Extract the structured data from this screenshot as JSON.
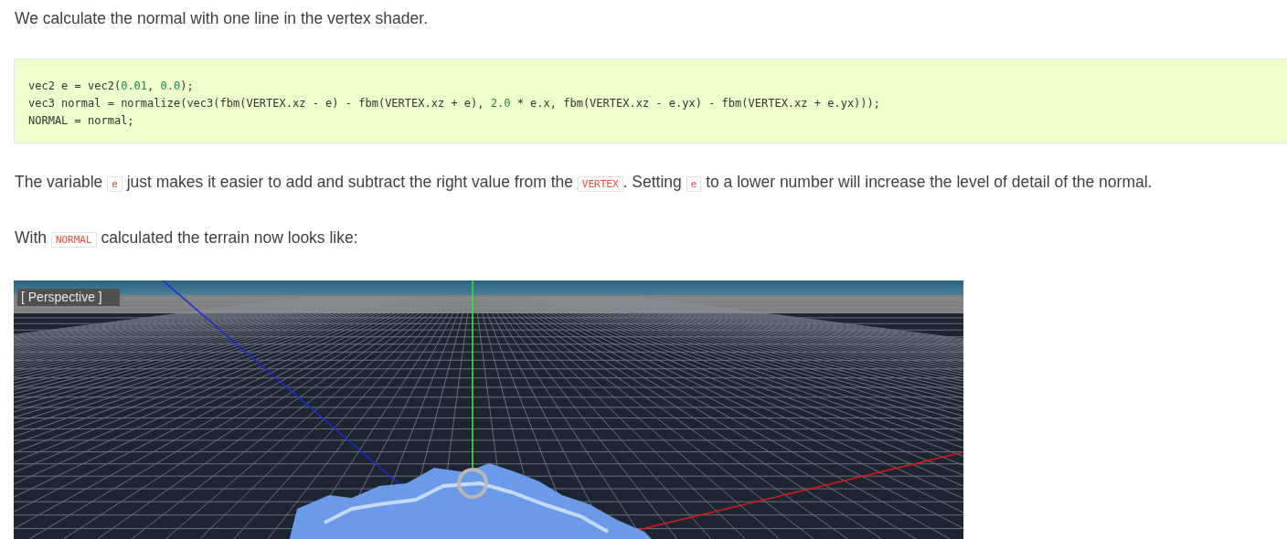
{
  "intro": "We calculate the normal with one line in the vertex shader.",
  "code_block": {
    "lines": [
      [
        {
          "kind": "plain",
          "text": "vec2 e = vec2("
        },
        {
          "kind": "number",
          "text": "0.01"
        },
        {
          "kind": "plain",
          "text": ", "
        },
        {
          "kind": "number",
          "text": "0.0"
        },
        {
          "kind": "plain",
          "text": ");"
        }
      ],
      [
        {
          "kind": "plain",
          "text": "vec3 normal = normalize(vec3(fbm(VERTEX.xz - e) - fbm(VERTEX.xz + e), "
        },
        {
          "kind": "number",
          "text": "2.0"
        },
        {
          "kind": "plain",
          "text": " * e.x, fbm(VERTEX.xz - e.yx) - fbm(VERTEX.xz + e.yx)));"
        }
      ],
      [
        {
          "kind": "plain",
          "text": "NORMAL = normal;"
        }
      ]
    ]
  },
  "paragraphs": [
    [
      {
        "kind": "text",
        "text": "The variable "
      },
      {
        "kind": "code",
        "text": "e"
      },
      {
        "kind": "text",
        "text": " just makes it easier to add and subtract the right value from the "
      },
      {
        "kind": "code",
        "text": "VERTEX"
      },
      {
        "kind": "text",
        "text": ". Setting "
      },
      {
        "kind": "code",
        "text": "e"
      },
      {
        "kind": "text",
        "text": " to a lower number will increase the level of detail of the normal."
      }
    ],
    [
      {
        "kind": "text",
        "text": "With "
      },
      {
        "kind": "code",
        "text": "NORMAL"
      },
      {
        "kind": "text",
        "text": " calculated the terrain now looks like:"
      }
    ]
  ],
  "viewport": {
    "label": "[ Perspective ]"
  }
}
